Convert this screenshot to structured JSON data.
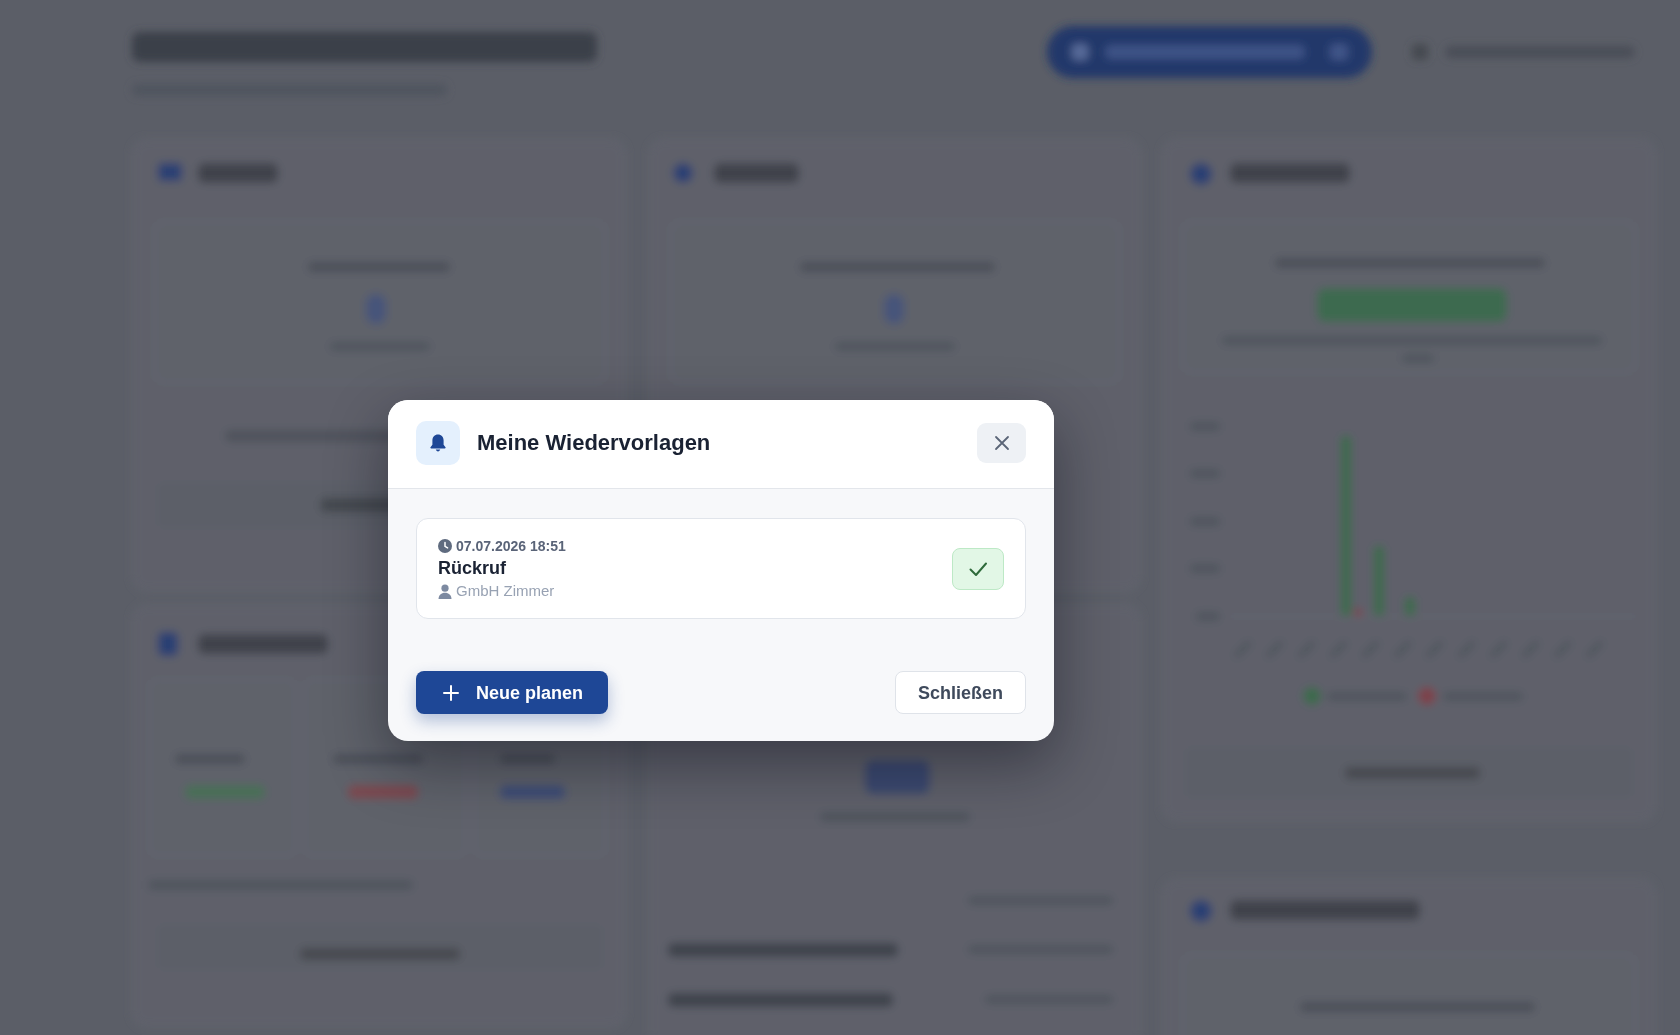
{
  "dialog": {
    "title": "Meine Wiedervorlagen",
    "reminders": [
      {
        "due": "07.07.2026 18:51",
        "subject": "Rückruf",
        "contact": "GmbH Zimmer"
      }
    ],
    "actions": [
      {
        "label": "Neue planen",
        "kind": "primary"
      },
      {
        "label": "Schließen",
        "kind": "secondary"
      }
    ]
  }
}
